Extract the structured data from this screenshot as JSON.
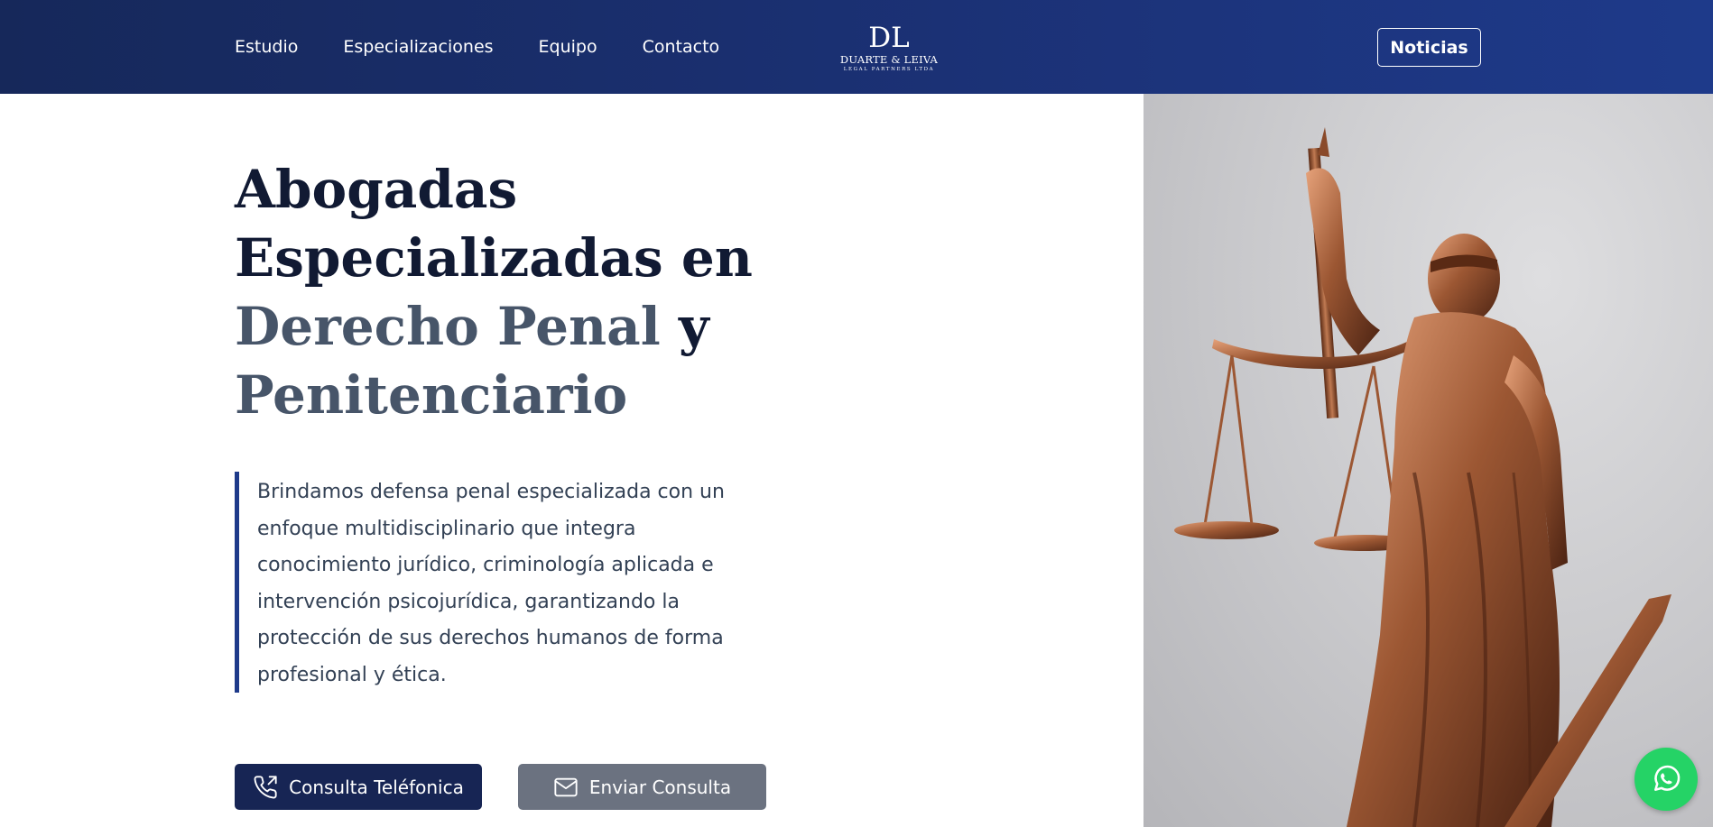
{
  "nav": {
    "links": [
      "Estudio",
      "Especializaciones",
      "Equipo",
      "Contacto"
    ],
    "logo_monogram": "DL",
    "logo_name": "DUARTE & LEIVA",
    "logo_subtitle": "LEGAL PARTNERS LTDA",
    "news_button": "Noticias"
  },
  "hero": {
    "title_line1": "Abogadas",
    "title_line2": "Especializadas en",
    "title_accent1": "Derecho Penal",
    "title_connector": " y",
    "title_accent2": "Penitenciario",
    "description": "Brindamos defensa penal especializada con un enfoque multidisciplinario que integra conocimiento jurídico, criminología aplicada e intervención psicojurídica, garantizando la protección de sus derechos humanos de forma profesional y ética.",
    "btn_phone": "Consulta Teléfonica",
    "btn_mail": "Enviar Consulta",
    "image_icon": "lady-justice-statue-image"
  },
  "colors": {
    "nav_bg": "#1b3175",
    "title": "#111a33",
    "accent": "#475569",
    "primary_button": "#172554",
    "secondary_button": "#6b7280",
    "whatsapp": "#25d366"
  },
  "floating": {
    "icon": "whatsapp-icon"
  }
}
